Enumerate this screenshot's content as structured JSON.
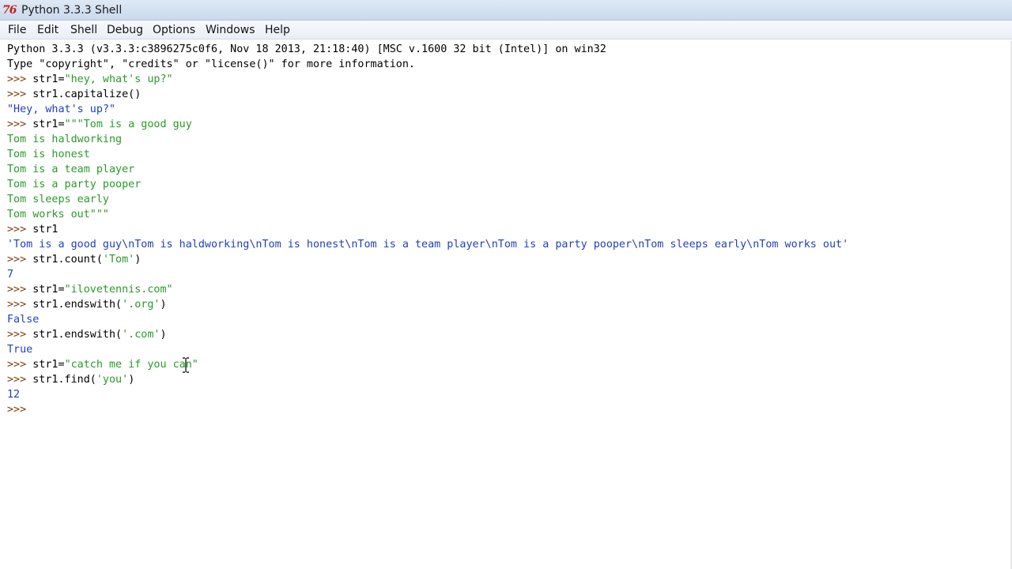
{
  "window": {
    "icon_glyph": "76",
    "title": "Python 3.3.3 Shell"
  },
  "menu": [
    "File",
    "Edit",
    "Shell",
    "Debug",
    "Options",
    "Windows",
    "Help"
  ],
  "shell": {
    "prompt": ">>> ",
    "lines": [
      {
        "kind": "out-plain",
        "text": "Python 3.3.3 (v3.3.3:c3896275c0f6, Nov 18 2013, 21:18:40) [MSC v.1600 32 bit (Intel)] on win32"
      },
      {
        "kind": "out-plain",
        "text": "Type \"copyright\", \"credits\" or \"license()\" for more information."
      },
      {
        "kind": "input",
        "code": "str1=",
        "str": "\"hey, what's up?\"",
        "tail": ""
      },
      {
        "kind": "input",
        "code": "str1.capitalize()",
        "str": "",
        "tail": ""
      },
      {
        "kind": "output",
        "text": "\"Hey, what's up?\""
      },
      {
        "kind": "input",
        "code": "str1=",
        "str": "\"\"\"Tom is a good guy",
        "tail": ""
      },
      {
        "kind": "cont",
        "text": "Tom is haldworking"
      },
      {
        "kind": "cont",
        "text": "Tom is honest"
      },
      {
        "kind": "cont",
        "text": "Tom is a team player"
      },
      {
        "kind": "cont",
        "text": "Tom is a party pooper"
      },
      {
        "kind": "cont",
        "text": "Tom sleeps early"
      },
      {
        "kind": "cont",
        "text": "Tom works out\"\"\""
      },
      {
        "kind": "input",
        "code": "str1",
        "str": "",
        "tail": ""
      },
      {
        "kind": "output",
        "text": "'Tom is a good guy\\nTom is haldworking\\nTom is honest\\nTom is a team player\\nTom is a party pooper\\nTom sleeps early\\nTom works out'"
      },
      {
        "kind": "input",
        "code": "str1.count(",
        "str": "'Tom'",
        "tail": ")"
      },
      {
        "kind": "output",
        "text": "7"
      },
      {
        "kind": "input",
        "code": "str1=",
        "str": "\"ilovetennis.com\"",
        "tail": ""
      },
      {
        "kind": "input",
        "code": "str1.endswith(",
        "str": "'.org'",
        "tail": ")"
      },
      {
        "kind": "output",
        "text": "False"
      },
      {
        "kind": "input",
        "code": "str1.endswith(",
        "str": "'.com'",
        "tail": ")"
      },
      {
        "kind": "output",
        "text": "True"
      },
      {
        "kind": "input",
        "code": "str1=",
        "str": "\"catch me if you can\"",
        "tail": ""
      },
      {
        "kind": "input",
        "code": "str1.find(",
        "str": "'you'",
        "tail": ")"
      },
      {
        "kind": "output",
        "text": "12"
      },
      {
        "kind": "input",
        "code": "",
        "str": "",
        "tail": ""
      }
    ]
  }
}
